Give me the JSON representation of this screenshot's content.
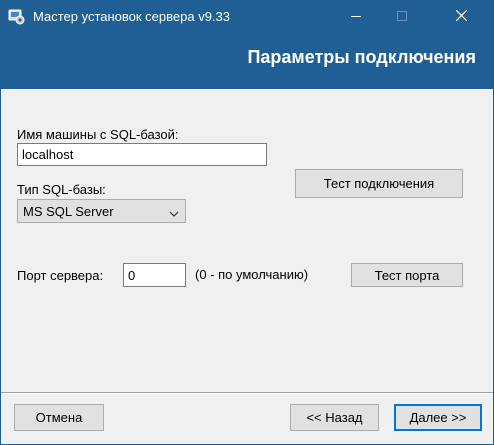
{
  "window": {
    "title": "Мастер установок сервера v9.33",
    "icons": {
      "app": "installer-icon",
      "minimize": "minimize-icon",
      "maximize": "maximize-icon",
      "close": "close-icon"
    }
  },
  "header": {
    "title": "Параметры подключения"
  },
  "form": {
    "host_label": "Имя машины с SQL-базой:",
    "host_value": "localhost",
    "db_type_label": "Тип SQL-базы:",
    "db_type_value": "MS SQL Server",
    "test_connection_label": "Тест подключения",
    "port_label": "Порт сервера:",
    "port_value": "0",
    "port_hint": "(0 - по умолчанию)",
    "test_port_label": "Тест порта"
  },
  "footer": {
    "cancel_label": "Отмена",
    "back_label": "<< Назад",
    "next_label": "Далее >>"
  },
  "colors": {
    "titlebar": "#1f5f95",
    "body": "#f0f0f0",
    "focus_border": "#0078d7"
  }
}
